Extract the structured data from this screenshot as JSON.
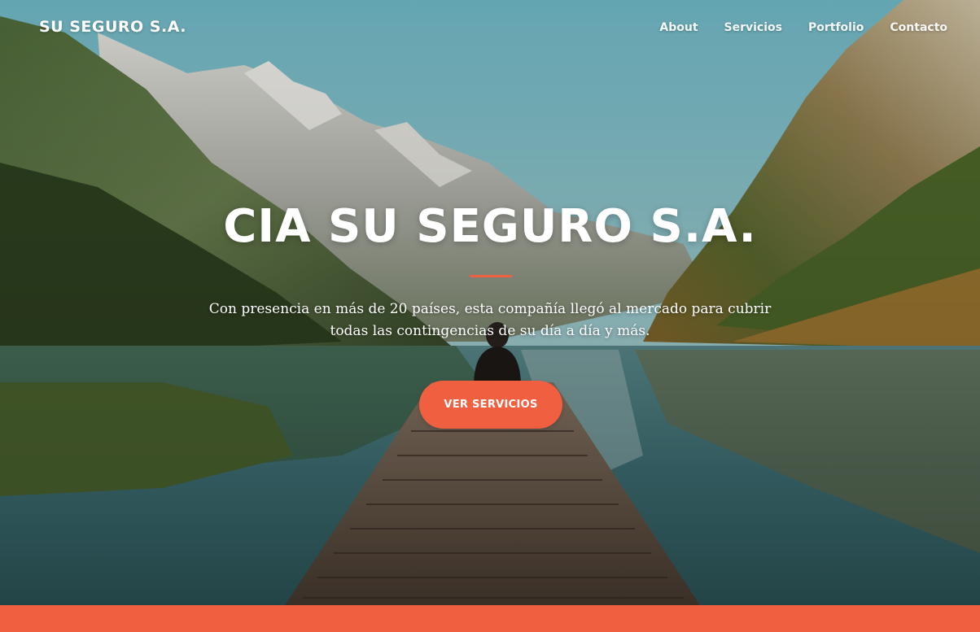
{
  "brand": {
    "name": "SU SEGURO S.A."
  },
  "nav": {
    "items": [
      {
        "label": "About"
      },
      {
        "label": "Servicios"
      },
      {
        "label": "Portfolio"
      },
      {
        "label": "Contacto"
      }
    ]
  },
  "hero": {
    "title": "CIA SU SEGURO S.A.",
    "subtitle_line1": "Con presencia en más de 20 países, esta compañía llegó al mercado para cubrir",
    "subtitle_line2": "todas las contingencias de su día a día y más.",
    "cta_label": "VER SERVICIOS",
    "background": "mountain-lake-dock-photo"
  },
  "colors": {
    "accent": "#f05f40",
    "text_on_hero": "#ffffff"
  }
}
